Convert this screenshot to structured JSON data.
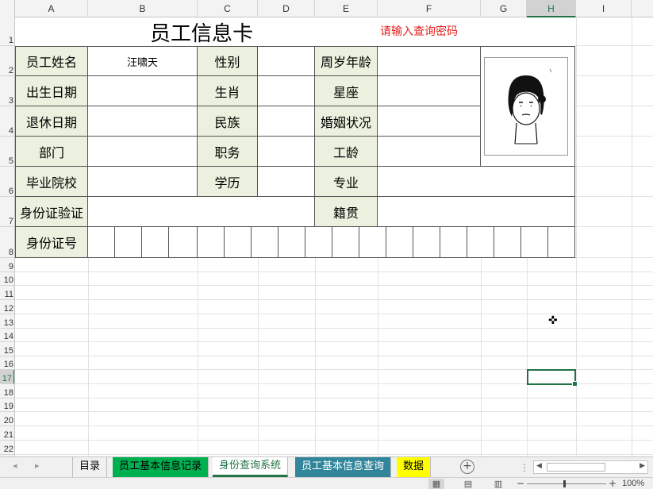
{
  "columns": [
    "A",
    "B",
    "C",
    "D",
    "E",
    "F",
    "G",
    "H",
    "I"
  ],
  "selected_column": "H",
  "rows": [
    "1",
    "2",
    "3",
    "4",
    "5",
    "6",
    "7",
    "8",
    "9",
    "10",
    "11",
    "12",
    "13",
    "14",
    "15",
    "16",
    "17",
    "18",
    "19",
    "20",
    "21",
    "22"
  ],
  "selected_row": "17",
  "card": {
    "title": "员工信息卡",
    "password_hint": "请输入查询密码",
    "labels": {
      "name": "员工姓名",
      "gender": "性别",
      "age": "周岁年龄",
      "birth_date": "出生日期",
      "zodiac": "生肖",
      "constellation": "星座",
      "retire_date": "退休日期",
      "ethnicity": "民族",
      "marital": "婚姻状况",
      "department": "部门",
      "position": "职务",
      "seniority": "工龄",
      "school": "毕业院校",
      "education": "学历",
      "major": "专业",
      "id_verify": "身份证验证",
      "native_place": "籍贯",
      "id_number": "身份证号"
    },
    "values": {
      "name": "汪啸天"
    },
    "photo_icon": "cartoon-face-portrait",
    "label_fill": "#ebf1de"
  },
  "sheet_tabs": [
    {
      "label": "目录",
      "color": "#f0f0f0",
      "text_color": "#000000"
    },
    {
      "label": "员工基本信息记录",
      "color": "#00b050",
      "text_color": "#000000"
    },
    {
      "label": "身份查询系统",
      "color": "#ffffff",
      "text_color": "#217346",
      "active": true
    },
    {
      "label": "员工基本信息查询",
      "color": "#31869b",
      "text_color": "#ffffff"
    },
    {
      "label": "数据",
      "color": "#ffff00",
      "text_color": "#000000"
    }
  ],
  "add_sheet_icon": "plus-circle-icon",
  "status": {
    "zoom_level": "100%",
    "view_icons": [
      "normal-view-icon",
      "page-layout-icon",
      "page-break-icon"
    ]
  },
  "accent_color": "#217346"
}
